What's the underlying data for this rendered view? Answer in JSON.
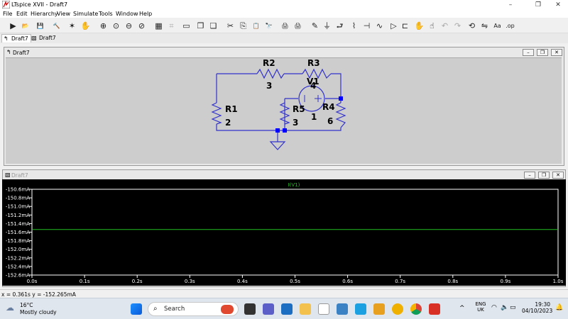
{
  "window": {
    "title": "LTspice XVII - Draft7"
  },
  "menu": [
    "File",
    "Edit",
    "Hierarchy",
    "View",
    "Simulate",
    "Tools",
    "Window",
    "Help"
  ],
  "toolbar": {
    "icons": [
      "run-icon",
      "open-icon",
      "save-icon",
      "control-panel-icon",
      "halt-icon",
      "hand-icon",
      "zoom-in-icon",
      "pan-icon",
      "zoom-out-icon",
      "zoom-cancel-icon",
      "autorange-icon",
      "grid-icon",
      "tile-horizontal-icon",
      "cascade-icon",
      "tile-vertical-icon",
      "cut-icon",
      "copy-icon",
      "paste-icon",
      "find-icon",
      "print-setup-icon",
      "print-icon",
      "draw-wire-icon",
      "ground-icon",
      "label-net-icon",
      "resistor-icon",
      "capacitor-icon",
      "inductor-icon",
      "diode-icon",
      "component-icon",
      "move-icon",
      "drag-icon",
      "undo-icon",
      "redo-icon",
      "rotate-icon",
      "mirror-icon",
      "text-icon",
      "spice-directive-icon"
    ],
    "glyphs": [
      "▶",
      "📂",
      "💾",
      "🔨",
      "✶",
      "✋",
      "⊕",
      "⊙",
      "⊖",
      "⊘",
      "▦",
      "⌗",
      "▭",
      "❐",
      "❏",
      "✂",
      "⎘",
      "📋",
      "🔭",
      "🖨",
      "🖨",
      "✎",
      "⏚",
      "⮐",
      "⌇",
      "⊣",
      "∿",
      "▷",
      "⊏",
      "✋",
      "☝",
      "↶",
      "↷",
      "⟲",
      "⇋",
      "Aa",
      ".op"
    ]
  },
  "tabs": [
    "Draft7",
    "Draft7"
  ],
  "schematic_window": {
    "title": "Draft7",
    "components": [
      {
        "ref": "R1",
        "value": "2"
      },
      {
        "ref": "R2",
        "value": "3"
      },
      {
        "ref": "R3",
        "value": "4"
      },
      {
        "ref": "R4",
        "value": "6"
      },
      {
        "ref": "R5",
        "value": "3"
      },
      {
        "ref": "V1",
        "value": "1"
      }
    ]
  },
  "waveform_window": {
    "title": "Draft7"
  },
  "chart_data": {
    "type": "line",
    "title": "I(V1)",
    "xlabel": "",
    "ylabel": "",
    "x_ticks": [
      "0.0s",
      "0.1s",
      "0.2s",
      "0.3s",
      "0.4s",
      "0.5s",
      "0.6s",
      "0.7s",
      "0.8s",
      "0.9s",
      "1.0s"
    ],
    "y_ticks": [
      "-150.6mA",
      "-150.8mA",
      "-151.0mA",
      "-151.2mA",
      "-151.4mA",
      "-151.6mA",
      "-151.8mA",
      "-152.0mA",
      "-152.2mA",
      "-152.4mA",
      "-152.6mA"
    ],
    "xlim": [
      0,
      1.0
    ],
    "ylim": [
      -152.6,
      -150.6
    ],
    "grid": false,
    "series": [
      {
        "name": "I(V1)",
        "color": "#22c022",
        "x": [
          0.0,
          1.0
        ],
        "y": [
          -151.538,
          -151.538
        ]
      }
    ]
  },
  "statusbar": {
    "text": "x = 0.361s   y = -152.265mA"
  },
  "taskbar": {
    "weather": {
      "temp": "16°C",
      "desc": "Mostly cloudy"
    },
    "search": "Search",
    "lang": "ENG",
    "region": "UK",
    "time": "19:30",
    "date": "04/10/2023"
  }
}
